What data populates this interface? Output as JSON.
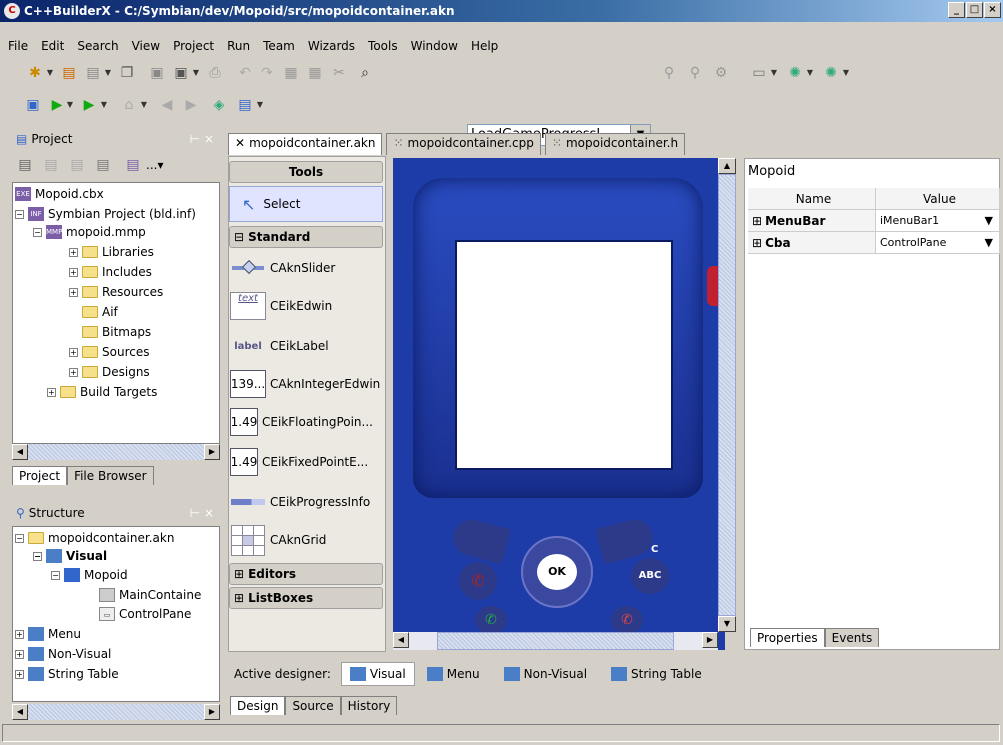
{
  "window": {
    "title": "C++BuilderX - C:/Symbian/dev/Mopoid/src/mopoidcontainer.akn"
  },
  "menu": [
    "File",
    "Edit",
    "Search",
    "View",
    "Project",
    "Run",
    "Team",
    "Wizards",
    "Tools",
    "Window",
    "Help"
  ],
  "toolbar": {
    "search_combo": "LoadGameProgressL"
  },
  "project_panel": {
    "title": "Project",
    "tree": [
      {
        "label": "Mopoid.cbx"
      },
      {
        "label": "Symbian Project (bld.inf)"
      },
      {
        "label": "mopoid.mmp"
      },
      {
        "label": "Libraries"
      },
      {
        "label": "Includes"
      },
      {
        "label": "Resources"
      },
      {
        "label": "Aif"
      },
      {
        "label": "Bitmaps"
      },
      {
        "label": "Sources"
      },
      {
        "label": "Designs"
      },
      {
        "label": "Build Targets"
      }
    ],
    "tabs": [
      "Project",
      "File Browser"
    ]
  },
  "structure_panel": {
    "title": "Structure",
    "tree": [
      {
        "label": "mopoidcontainer.akn"
      },
      {
        "label": "Visual"
      },
      {
        "label": "Mopoid"
      },
      {
        "label": "MainContaine"
      },
      {
        "label": "ControlPane"
      },
      {
        "label": "Menu"
      },
      {
        "label": "Non-Visual"
      },
      {
        "label": "String Table"
      }
    ]
  },
  "editor_tabs": [
    "mopoidcontainer.akn",
    "mopoidcontainer.cpp",
    "mopoidcontainer.h"
  ],
  "palette": {
    "tools_label": "Tools",
    "select_label": "Select",
    "standard_label": "Standard",
    "items": [
      {
        "label": "CAknSlider",
        "icon": ""
      },
      {
        "label": "CEikEdwin",
        "icon": "text"
      },
      {
        "label": "CEikLabel",
        "icon": "label"
      },
      {
        "label": "CAknIntegerEdwin",
        "icon": "139..."
      },
      {
        "label": "CEikFloatingPoin...",
        "icon": "1.49"
      },
      {
        "label": "CEikFixedPointE...",
        "icon": "1.49"
      },
      {
        "label": "CEikProgressInfo",
        "icon": ""
      },
      {
        "label": "CAknGrid",
        "icon": ""
      }
    ],
    "editors_label": "Editors",
    "listboxes_label": "ListBoxes"
  },
  "phone": {
    "ok": "OK",
    "abc": "ABC",
    "c": "C"
  },
  "properties": {
    "component": "Mopoid",
    "col_name": "Name",
    "col_value": "Value",
    "rows": [
      {
        "name": "MenuBar",
        "value": "iMenuBar1"
      },
      {
        "name": "Cba",
        "value": "ControlPane"
      }
    ],
    "tabs": [
      "Properties",
      "Events"
    ]
  },
  "designer": {
    "label": "Active designer:",
    "buttons": [
      "Visual",
      "Menu",
      "Non-Visual",
      "String Table"
    ]
  },
  "bottom_tabs": [
    "Design",
    "Source",
    "History"
  ],
  "colors": {
    "phone_body": "#1e3ca8",
    "selection": "#e0e4ff",
    "title_bar": "#0a246a"
  }
}
